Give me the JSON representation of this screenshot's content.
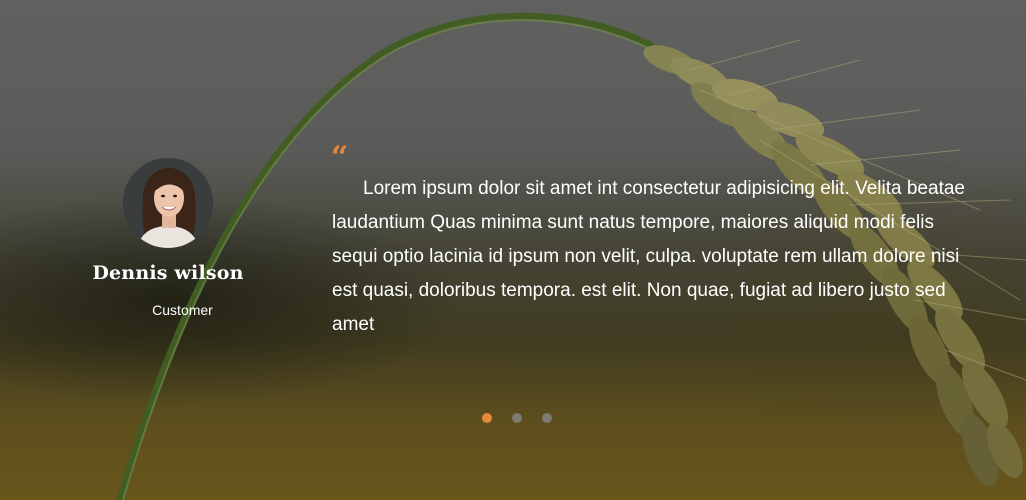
{
  "testimonial": {
    "author_name": "Dennis wilson",
    "author_role": "Customer",
    "quote_mark": "“",
    "quote": "Lorem ipsum dolor sit amet int consectetur adipisicing elit. Velita beatae laudantium Quas minima sunt natus tempore, maiores aliquid modi felis sequi optio lacinia id ipsum non velit, culpa. voluptate rem ullam dolore nisi est quasi, doloribus tempora. est elit. Non quae, fugiat ad libero justo sed amet"
  },
  "slider": {
    "total_slides": 3,
    "active_index": 0
  },
  "colors": {
    "accent": "#e58a3c",
    "inactive_dot": "#7c7b72",
    "text": "#ffffff"
  },
  "icons": {
    "quote": "quote-icon",
    "background": "wheat-ear-image"
  }
}
